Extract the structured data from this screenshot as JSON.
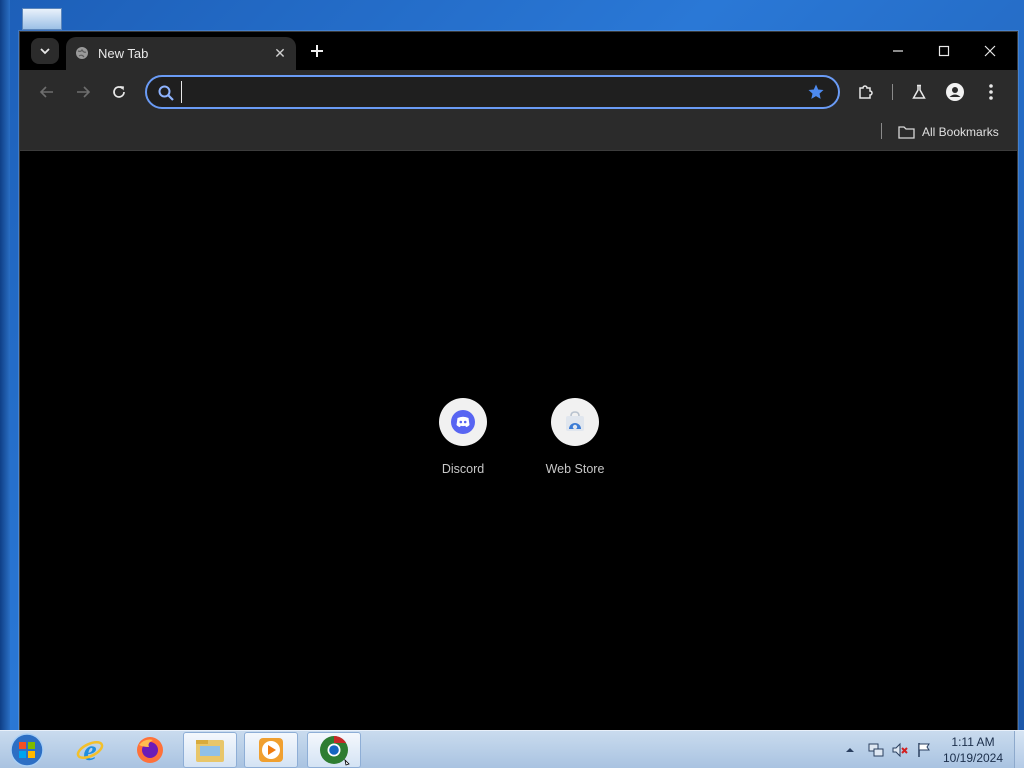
{
  "browser": {
    "tab": {
      "title": "New Tab",
      "close_glyph": "✕"
    },
    "omnibox": {
      "value": "",
      "placeholder": ""
    },
    "bookmarks_bar": {
      "all_bookmarks_label": "All Bookmarks"
    },
    "accent_color": "#6a9bf5"
  },
  "new_tab_page": {
    "shortcuts": [
      {
        "label": "Discord",
        "icon": "discord-icon"
      },
      {
        "label": "Web Store",
        "icon": "web-store-icon"
      }
    ]
  },
  "taskbar": {
    "clock": {
      "time": "1:11 AM",
      "date": "10/19/2024"
    },
    "pinned": [
      {
        "name": "internet-explorer-icon"
      },
      {
        "name": "firefox-icon"
      },
      {
        "name": "file-explorer-icon"
      },
      {
        "name": "media-player-icon"
      },
      {
        "name": "chrome-icon",
        "active": true
      }
    ]
  }
}
